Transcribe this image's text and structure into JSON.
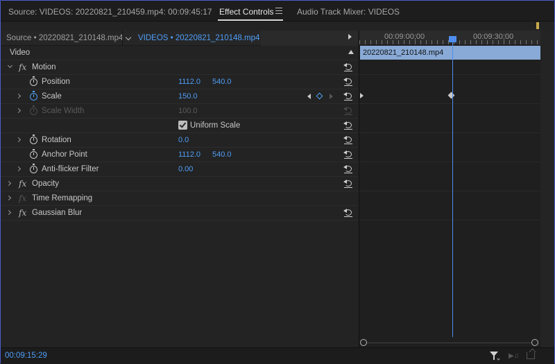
{
  "tabs": {
    "source": "Source: VIDEOS: 20220821_210459.mp4: 00:09:45:17",
    "effect_controls": "Effect Controls",
    "audio_mixer": "Audio Track Mixer: VIDEOS"
  },
  "header": {
    "source_clip": "Source • 20220821_210148.mp4",
    "sequence_clip": "VIDEOS • 20220821_210148.mp4"
  },
  "sections": {
    "video": "Video"
  },
  "effects": {
    "motion": {
      "name": "Motion",
      "position": {
        "label": "Position",
        "x": "1112.0",
        "y": "540.0"
      },
      "scale": {
        "label": "Scale",
        "value": "150.0"
      },
      "scale_width": {
        "label": "Scale Width",
        "value": "100.0"
      },
      "uniform_scale": {
        "label": "Uniform Scale",
        "checked": true
      },
      "rotation": {
        "label": "Rotation",
        "value": "0.0"
      },
      "anchor_point": {
        "label": "Anchor Point",
        "x": "1112.0",
        "y": "540.0"
      },
      "anti_flicker": {
        "label": "Anti-flicker Filter",
        "value": "0.00"
      }
    },
    "opacity": {
      "name": "Opacity"
    },
    "time_remapping": {
      "name": "Time Remapping"
    },
    "gaussian_blur": {
      "name": "Gaussian Blur"
    }
  },
  "timeline": {
    "ruler_labels": [
      "00:09:00;00",
      "00:09:30;00"
    ],
    "clip_name": "20220821_210148.mp4"
  },
  "footer": {
    "timecode": "00:09:15:29"
  },
  "icons": {
    "fx": "fx",
    "reset": "reset-parameter-icon",
    "stopwatch": "toggle-animation-stopwatch-icon",
    "filter": "filter-icon"
  },
  "colors": {
    "accent_blue": "#4f9ef7",
    "clip_blue": "#89aad6",
    "panel_bg": "#232323"
  }
}
